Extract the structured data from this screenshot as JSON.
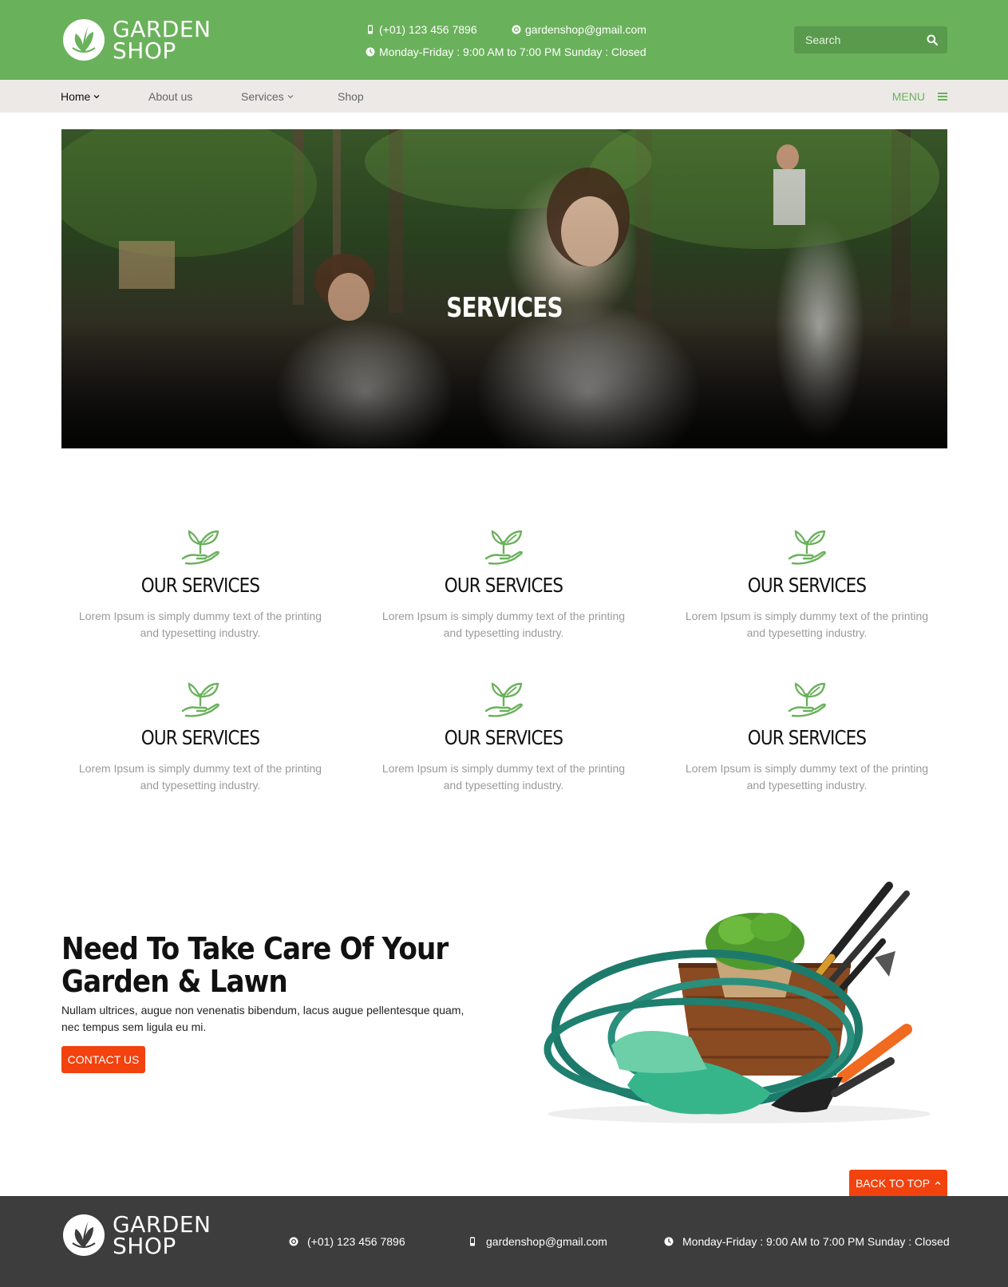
{
  "header": {
    "logo": {
      "line1": "GARDEN",
      "line2": "SHOP"
    },
    "phone": "(+01) 123 456 7896",
    "email": "gardenshop@gmail.com",
    "hours": "Monday-Friday : 9:00 AM to 7:00 PM Sunday : Closed",
    "search": {
      "placeholder": "Search",
      "value": ""
    }
  },
  "nav": {
    "items": [
      {
        "label": "Home",
        "active": true,
        "has_dropdown": true
      },
      {
        "label": "About us",
        "active": false,
        "has_dropdown": false
      },
      {
        "label": "Services",
        "active": false,
        "has_dropdown": true
      },
      {
        "label": "Shop",
        "active": false,
        "has_dropdown": false
      }
    ],
    "menu_label": "MENU"
  },
  "hero": {
    "title": "SERVICES"
  },
  "services": [
    {
      "title": "OUR SERVICES",
      "text": "Lorem Ipsum is simply dummy text of the printing and typesetting industry."
    },
    {
      "title": "OUR SERVICES",
      "text": "Lorem Ipsum is simply dummy text of the printing and typesetting industry."
    },
    {
      "title": "OUR SERVICES",
      "text": "Lorem Ipsum is simply dummy text of the printing and typesetting industry."
    },
    {
      "title": "OUR SERVICES",
      "text": "Lorem Ipsum is simply dummy text of the printing and typesetting industry."
    },
    {
      "title": "OUR SERVICES",
      "text": "Lorem Ipsum is simply dummy text of the printing and typesetting industry."
    },
    {
      "title": "OUR SERVICES",
      "text": "Lorem Ipsum is simply dummy text of the printing and typesetting industry."
    }
  ],
  "cta": {
    "title": "Need To Take Care Of Your Garden & Lawn",
    "text": "Nullam ultrices, augue non venenatis bibendum, lacus augue pellentesque quam, nec tempus sem ligula eu mi.",
    "button_label": "CONTACT US"
  },
  "back_to_top_label": "BACK TO TOP",
  "footer": {
    "logo": {
      "line1": "GARDEN",
      "line2": "SHOP"
    },
    "phone": "(+01) 123 456 7896",
    "email": "gardenshop@gmail.com",
    "hours": "Monday-Friday : 9:00 AM to 7:00 PM Sunday : Closed"
  },
  "colors": {
    "brand_green": "#6ab15b",
    "nav_bg": "#ece9e7",
    "accent_orange": "#f2420e",
    "footer_bg": "#3d3d3d",
    "muted_text": "#9a9a9a"
  },
  "icons": {
    "logo": "leaf-circle-icon",
    "phone": "phone-icon",
    "email": "at-icon",
    "hours": "clock-icon",
    "search": "search-icon",
    "menu": "hamburger-icon",
    "service": "hand-plant-icon"
  }
}
